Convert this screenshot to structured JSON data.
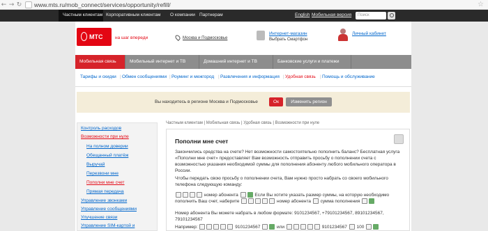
{
  "browser": {
    "url": "www.mts.ru/mob_connect/services/opportunity/refill/"
  },
  "topnav": {
    "items": [
      "Частным клиентам",
      "Корпоративным клиентам",
      "О компании",
      "Партнерам"
    ],
    "english": "English",
    "mobile": "Мобильная версия",
    "search_placeholder": "Поиск"
  },
  "header": {
    "logo": "МТС",
    "slogan": "на шаг впереди",
    "region": "Москва и Подмосковье",
    "shop_link": "Интернет-магазин",
    "shop_sub": "Выбрать Смартфон",
    "cabinet": "Личный кабинет"
  },
  "tabs": [
    "Мобильная связь",
    "Мобильный интернет и ТВ",
    "Домашний интернет и ТВ",
    "Банковские услуги и платежи"
  ],
  "subnav": [
    "Тарифы и скидки",
    "Обмен сообщениями",
    "Роуминг и межгород",
    "Развлечения и информация",
    "Удобная связь",
    "Помощь и обслуживание"
  ],
  "banner": {
    "message": "Вы находитесь в регионе Москва и Подмосковье",
    "ok": "Ок",
    "change": "Изменить регион"
  },
  "leftmenu": [
    "Контроль расходов",
    "Возможности при нуле",
    "На полном доверии",
    "Обещанный платёж",
    "Выручай",
    "Перезвони мне",
    "Пополни мне счет",
    "Прямая передача",
    "Управление звонками",
    "Управление сообщениями",
    "Улучшение связи",
    "Управление SIM-картой и"
  ],
  "content": {
    "breadcrumb": "Частным клиентам | Мобильная связь | Удобная связь | Возможности при нуле",
    "title": "Пополни мне счет",
    "p1": "Закончились средства на счете? Нет возможности самостоятельно пополнить баланс? Бесплатная услуга «Пополни мне счет» предоставляет Вам возможность отправить просьбу о пополнении счета с возможностью указания необходимой суммы для пополнения абоненту любого мобильного оператора в России.",
    "p2": "Чтобы передать свою просьбу о пополнении счета, Вам нужно просто набрать со своего мобильного телефона следующую команду:",
    "cmd_a": "номер абонента",
    "cmd_b": "Если Вы хотите указать размер суммы, на которую необходимо пополнить Ваш счет, наберите",
    "cmd_c": "номер абонента",
    "cmd_d": "сумма пополнения",
    "p3": "Номер абонента Вы можете набрать в любом формате: 9101234567, +79101234567, 89101234567, 79101234567",
    "example": "Например:",
    "ex1": "9101234567",
    "or": "или",
    "ex2": "9101234567",
    "ex_sum": "100"
  }
}
